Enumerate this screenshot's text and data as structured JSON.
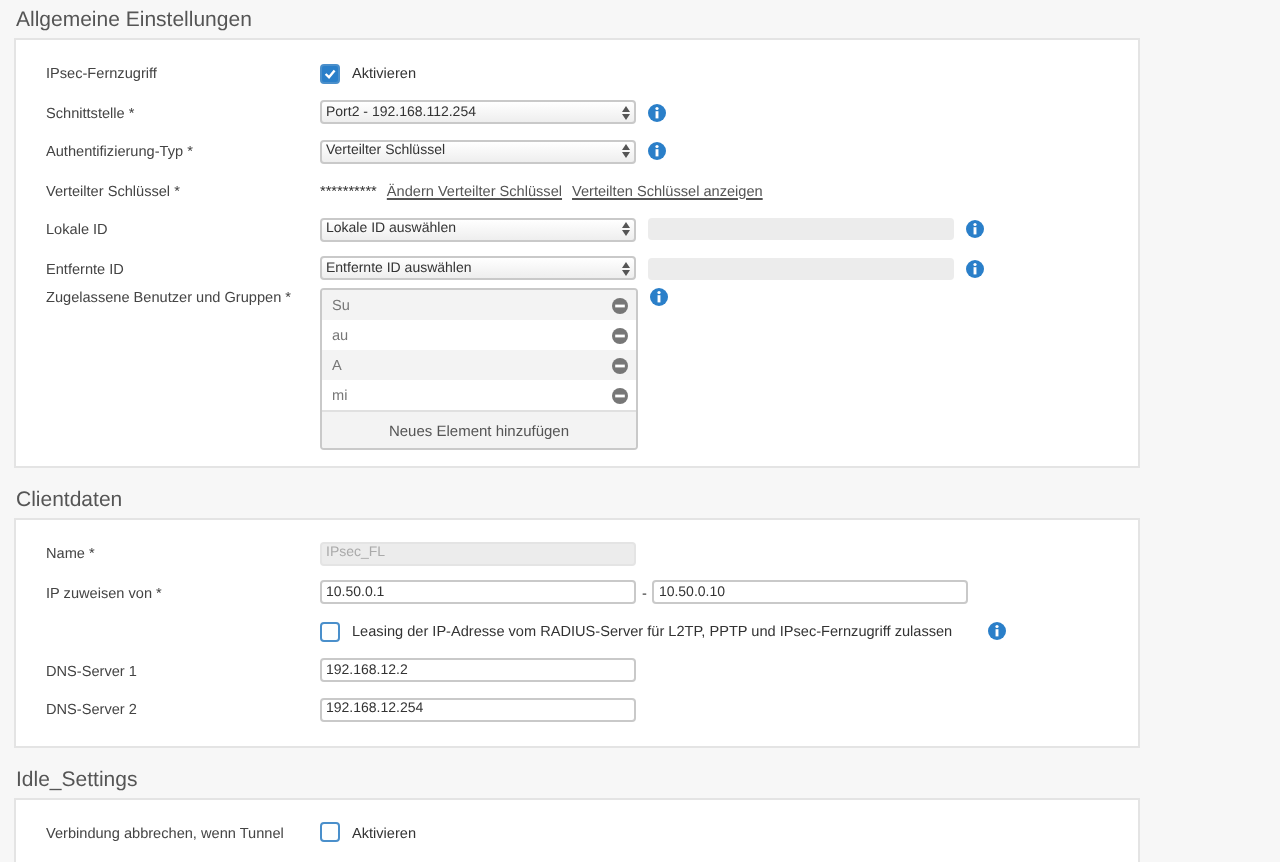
{
  "sections": [
    {
      "title": "Allgemeine Einstellungen",
      "rows": [
        {
          "kind": "checkbox",
          "label": "IPsec-Fernzugriff",
          "checked": true,
          "text": "Aktivieren"
        },
        {
          "kind": "select",
          "label": "Schnittstelle *",
          "value": "Port2 - 192.168.112.254",
          "info": true
        },
        {
          "kind": "select",
          "label": "Authentifizierung-Typ *",
          "value": "Verteilter Schlüssel",
          "info": true
        },
        {
          "kind": "secret",
          "label": "Verteilter Schlüssel *",
          "value": "**********",
          "links": [
            "Ändern Verteilter Schlüssel",
            "Verteilten Schlüssel anzeigen"
          ]
        },
        {
          "kind": "select-input",
          "label": "Lokale ID",
          "value": "Lokale ID auswählen",
          "info": true
        },
        {
          "kind": "select-input",
          "label": "Entfernte ID",
          "value": "Entfernte ID auswählen",
          "info": true
        },
        {
          "kind": "list",
          "label": "Zugelassene Benutzer und Gruppen *",
          "items": [
            "Su",
            "au",
            "A",
            "mi"
          ],
          "add": "Neues Element hinzufügen",
          "info": true
        }
      ]
    },
    {
      "title": "Clientdaten",
      "rows": [
        {
          "kind": "input",
          "label": "Name *",
          "value": "IPsec_FL",
          "disabled": true
        },
        {
          "kind": "range",
          "label": "IP zuweisen von *",
          "from": "10.50.0.1",
          "separator": "-",
          "to": "10.50.0.10"
        },
        {
          "kind": "checkbox",
          "checked": false,
          "text": "Leasing der IP-Adresse vom RADIUS-Server für L2TP, PPTP und IPsec-Fernzugriff zulassen",
          "info": true
        },
        {
          "kind": "input",
          "label": "DNS-Server 1",
          "value": "192.168.12.2",
          "disabled": false
        },
        {
          "kind": "input",
          "label": "DNS-Server 2",
          "value": "192.168.12.254",
          "disabled": false
        }
      ]
    },
    {
      "title": "Idle_Settings",
      "rows": [
        {
          "kind": "checkbox",
          "label": "Verbindung abbrechen, wenn Tunnel",
          "checked": false,
          "text": "Aktivieren"
        }
      ]
    }
  ]
}
